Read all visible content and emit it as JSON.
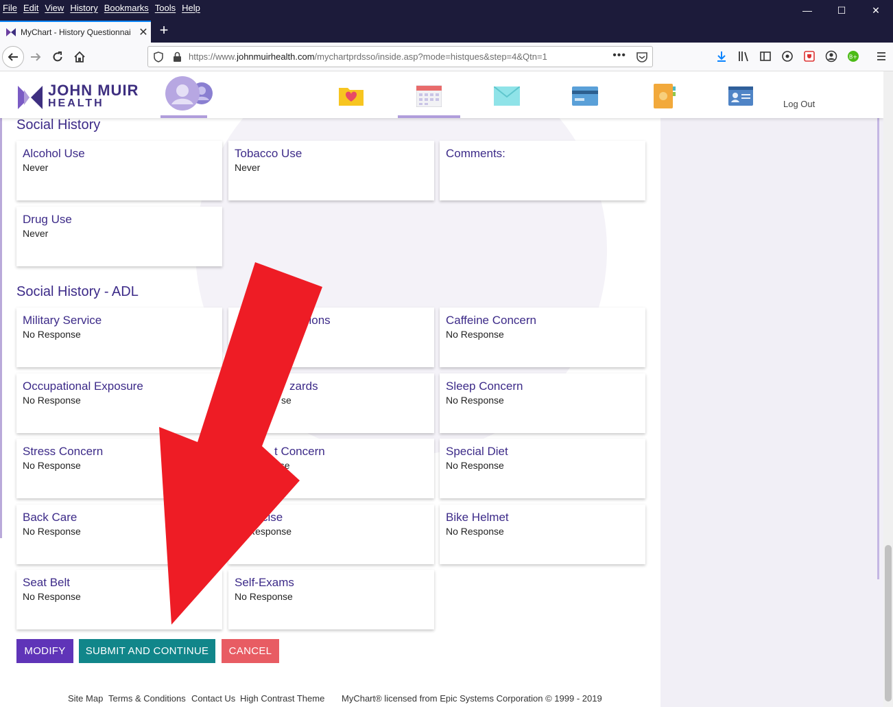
{
  "menubar": {
    "items": [
      "File",
      "Edit",
      "View",
      "History",
      "Bookmarks",
      "Tools",
      "Help"
    ]
  },
  "tab": {
    "title": "MyChart - History Questionnai"
  },
  "urlbar": {
    "url_prefix": "https://www.",
    "url_domain": "johnmuirhealth.com",
    "url_path": "/mychartprdsso/inside.asp?mode=histques&step=4&Qtn=1"
  },
  "header": {
    "logo_line1": "JOHN MUIR",
    "logo_line2": "HEALTH",
    "logout": "Log Out"
  },
  "social_history": {
    "title": "Social History",
    "cards": [
      {
        "title": "Alcohol Use",
        "value": "Never"
      },
      {
        "title": "Tobacco Use",
        "value": "Never"
      },
      {
        "title": "Comments:",
        "value": ""
      },
      {
        "title": "Drug Use",
        "value": "Never"
      }
    ]
  },
  "social_history_adl": {
    "title": "Social History - ADL",
    "cards": [
      {
        "title": "Military Service",
        "value": "No Response"
      },
      {
        "title": "sions",
        "value": ""
      },
      {
        "title": "Caffeine Concern",
        "value": "No Response"
      },
      {
        "title": "Occupational Exposure",
        "value": "No Response"
      },
      {
        "title": "zards",
        "value": "se"
      },
      {
        "title": "Sleep Concern",
        "value": "No Response"
      },
      {
        "title": "Stress Concern",
        "value": "No Response"
      },
      {
        "title": "t Concern",
        "value": "nse"
      },
      {
        "title": "Special Diet",
        "value": "No Response"
      },
      {
        "title": "Back Care",
        "value": "No Response"
      },
      {
        "title": "cise",
        "value": "Response"
      },
      {
        "title": "Bike Helmet",
        "value": "No Response"
      },
      {
        "title": "Seat Belt",
        "value": "No Response"
      },
      {
        "title": "Self-Exams",
        "value": "No Response"
      }
    ]
  },
  "buttons": {
    "modify": "MODIFY",
    "submit": "SUBMIT AND CONTINUE",
    "cancel": "CANCEL"
  },
  "footer": {
    "site_map": "Site Map",
    "terms": "Terms & Conditions",
    "contact": "Contact Us",
    "high_contrast": "High Contrast Theme",
    "license": "MyChart® licensed from Epic Systems Corporation © 1999 - 2019"
  },
  "colors": {
    "brand_purple": "#3c2a88",
    "modify": "#5f34b8",
    "submit": "#11868a",
    "cancel": "#e85c63",
    "annotation_arrow": "#ee1c25"
  }
}
